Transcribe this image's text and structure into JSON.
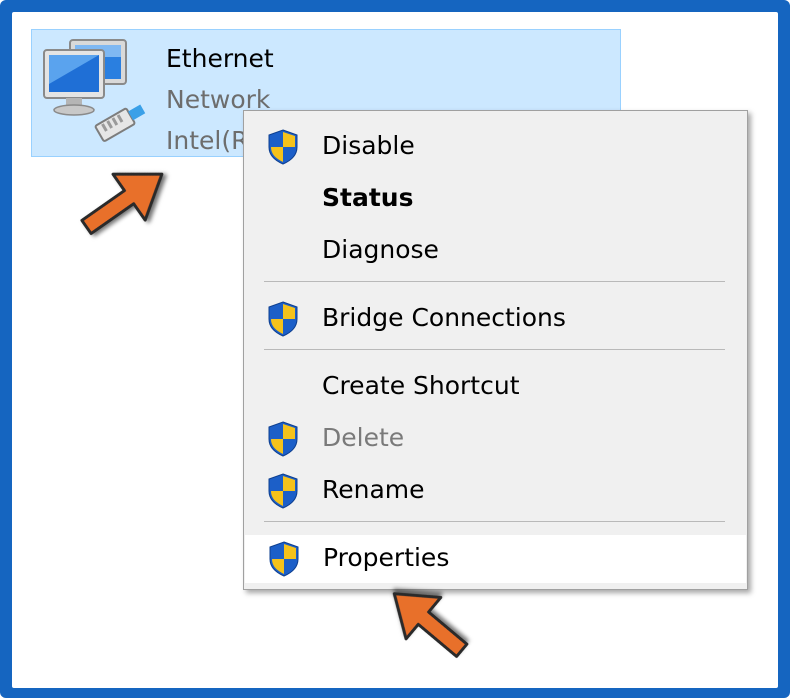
{
  "adapter": {
    "name": "Ethernet",
    "status": "Network",
    "device": "Intel(R"
  },
  "context_menu": {
    "items": [
      {
        "label": "Disable",
        "shield": true
      },
      {
        "label": "Status",
        "shield": false,
        "bold": true
      },
      {
        "label": "Diagnose",
        "shield": false
      },
      {
        "label": "Bridge Connections",
        "shield": true
      },
      {
        "label": "Create Shortcut",
        "shield": false
      },
      {
        "label": "Delete",
        "shield": true,
        "disabled": true
      },
      {
        "label": "Rename",
        "shield": true
      },
      {
        "label": "Properties",
        "shield": true,
        "highlighted": true
      }
    ]
  },
  "colors": {
    "frame": "#1565c0",
    "selection": "#cce8ff",
    "arrow": "#e8702a",
    "shield_blue": "#1c5fc8",
    "shield_yellow": "#f5c21b"
  },
  "icons": [
    "network-adapter-icon",
    "uac-shield-icon",
    "pointer-arrow-icon"
  ]
}
